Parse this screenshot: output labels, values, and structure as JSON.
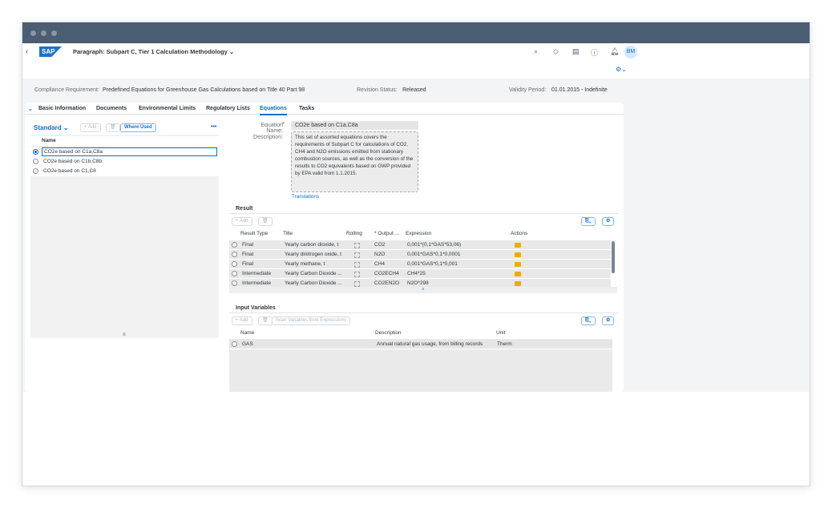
{
  "shell": {
    "logo": "SAP",
    "title": "Paragraph: Subpart C, Tier 1 Calculation Methodology",
    "avatar": "BM",
    "icons": [
      "search-icon",
      "diamond-icon",
      "chat-icon",
      "help-icon",
      "bell-icon"
    ]
  },
  "header": {
    "compliance_label": "Compliance Requirement:",
    "compliance_value": "Predefined Equations for Greenhouse Gas Calculations based on Title 40 Part 98",
    "revision_label": "Revision Status:",
    "revision_value": "Released",
    "validity_label": "Validity Period:",
    "validity_value": "01.01.2015 - Indefinite"
  },
  "tabs": [
    "Basic Information",
    "Documents",
    "Environmental Limits",
    "Regulatory Lists",
    "Equations",
    "Tasks"
  ],
  "left": {
    "variant": "Standard",
    "add": "+ Add",
    "where_used": "Where Used",
    "more": "•••",
    "col_name": "Name",
    "items": [
      "CO2e based on C1a,C8a",
      "CO2e based on C1b,C8b",
      "CO2e based on C1,C8"
    ]
  },
  "form": {
    "name_label": "Equation Name:",
    "name_value": "CO2e based on C1a,C8a",
    "desc_label": "Description:",
    "desc_value": "This set of assorted equations covers the requirements of Subpart C for calculations of CO2, CH4 and N2O emissions emitted from stationary combustion sources, as well as the conversion of the results to CO2 equivalents based on GWP provided by EPA valid from 1.1.2015.",
    "translations": "Translations"
  },
  "result": {
    "title": "Result",
    "add": "+ Add",
    "columns": [
      "Result Type",
      "Title",
      "Rolling",
      "* Output ...",
      "Expression",
      "Actions"
    ],
    "rows": [
      [
        "Final",
        "Yearly carbon dioxide, t",
        "CO2",
        "0,001*(0,1*GAS*53,06)"
      ],
      [
        "Final",
        "Yearly dinitrogen oxide, t",
        "N2O",
        "0,001*GAS*0,1*0,0001"
      ],
      [
        "Final",
        "Yearly methane, t",
        "CH4",
        "0,001*GAS*0,1*0,001"
      ],
      [
        "Intermediate",
        "Yearly Carbon Dioxide ...",
        "CO2ECH4",
        "CH4*25"
      ],
      [
        "Intermediate",
        "Yearly Carbon Dioxide ...",
        "CO2EN2O",
        "N2O*298"
      ]
    ]
  },
  "inputs": {
    "title": "Input Variables",
    "add": "+ Add",
    "scan": "Scan Variables from Expressions",
    "columns": [
      "Name",
      "Description",
      "Unit"
    ],
    "rows": [
      [
        "GAS",
        "Annual natural gas usage, from billing records",
        "Therm"
      ]
    ]
  },
  "colors": {
    "accent": "#0a6ed1",
    "titlebar": "#4b5d73",
    "flag": "#f0ab00"
  }
}
